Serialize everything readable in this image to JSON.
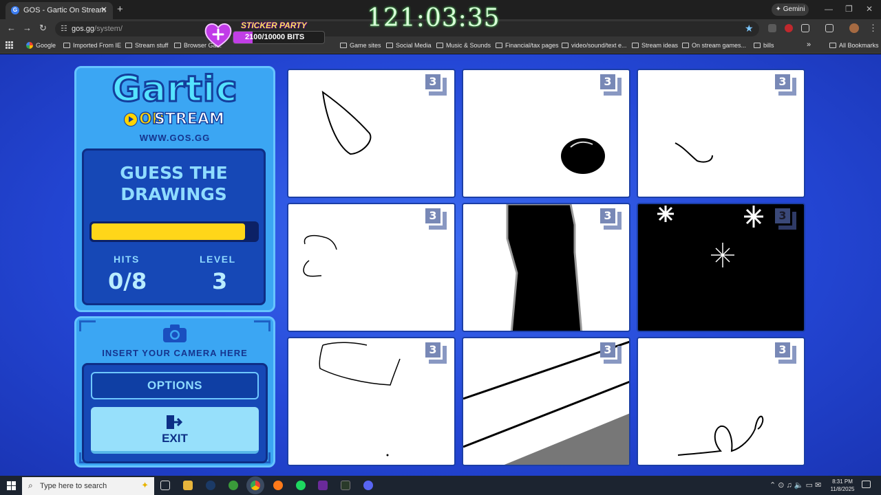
{
  "browser": {
    "tab_title": "GOS - Gartic On Stream",
    "tab_favicon": "G",
    "new_tab_symbol": "+",
    "url_domain": "gos.gg",
    "url_path": "/system/",
    "gemini_label": "✦ Gemini",
    "bookmarks": [
      {
        "label": "Google",
        "icon": "google-icon"
      },
      {
        "label": "Imported From IE",
        "icon": "folder-icon"
      },
      {
        "label": "Stream stuff",
        "icon": "folder-icon"
      },
      {
        "label": "Browser Ga...",
        "icon": "folder-icon"
      },
      {
        "label": "Game sites",
        "icon": "folder-icon"
      },
      {
        "label": "Social Media",
        "icon": "folder-icon"
      },
      {
        "label": "Music & Sounds",
        "icon": "folder-icon"
      },
      {
        "label": "Financial/tax pages",
        "icon": "folder-icon"
      },
      {
        "label": "video/sound/text e...",
        "icon": "folder-icon"
      },
      {
        "label": "Stream ideas",
        "icon": "folder-icon"
      },
      {
        "label": "On stream games...",
        "icon": "folder-icon"
      },
      {
        "label": "bills",
        "icon": "folder-icon"
      }
    ],
    "more_bookmarks": "»",
    "all_bookmarks": "All Bookmarks"
  },
  "overlay": {
    "timer": "121:03:35",
    "sticker_title": "STICKER PARTY",
    "bits_text": "2100/10000 BITS",
    "bits_fraction": 0.21
  },
  "game": {
    "logo_main": "Gartic",
    "logo_on": "ON",
    "logo_stream": "STREAM",
    "site": "WWW.GOS.GG",
    "mode_title_line1": "GUESS THE",
    "mode_title_line2": "DRAWINGS",
    "timer_fraction": 0.93,
    "hits_label": "HITS",
    "hits_value": "0/8",
    "level_label": "LEVEL",
    "level_value": "3",
    "camera_text": "INSERT YOUR CAMERA HERE",
    "options_label": "OPTIONS",
    "exit_label": "EXIT",
    "cells": [
      {
        "badge": "3"
      },
      {
        "badge": "3"
      },
      {
        "badge": "3"
      },
      {
        "badge": "3"
      },
      {
        "badge": "3"
      },
      {
        "badge": "3"
      },
      {
        "badge": "3"
      },
      {
        "badge": "3"
      },
      {
        "badge": "3"
      }
    ]
  },
  "taskbar": {
    "search_placeholder": "Type here to search",
    "time": "8:31 PM",
    "date": "11/8/2025"
  },
  "colors": {
    "page_bg": "#2447d6",
    "panel": "#3ba6f3",
    "progress": "#ffd619",
    "logo_cyan": "#55e3ff"
  }
}
